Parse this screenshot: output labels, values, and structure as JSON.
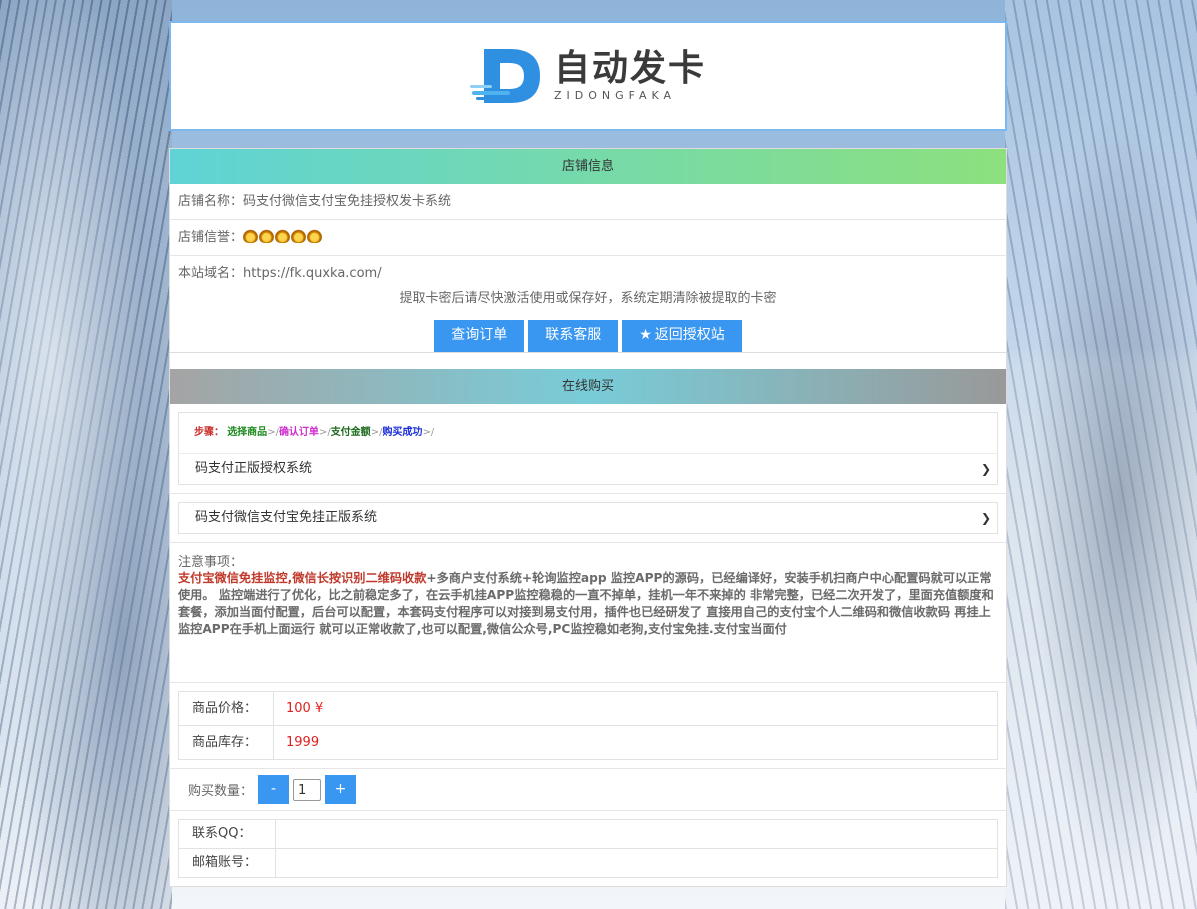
{
  "logo": {
    "title": "自动发卡",
    "subtitle": "ZIDONGFAKA"
  },
  "shop": {
    "header": "店铺信息",
    "name_label": "店铺名称：",
    "name_value": "码支付微信支付宝免挂授权发卡系统",
    "credit_label": "店铺信誉：",
    "credit_crowns": 5,
    "domain_label": "本站域名：",
    "domain_value": "https://fk.quxka.com/",
    "notice": "提取卡密后请尽快激活使用或保存好，系统定期清除被提取的卡密",
    "buttons": {
      "query": "查询订单",
      "contact": "联系客服",
      "back": "返回授权站"
    }
  },
  "buy": {
    "header": "在线购买",
    "steps": {
      "label": "步骤：",
      "s1": "选择商品",
      "s2": "确认订单",
      "s3": "支付金额",
      "s4": "购买成功",
      "arrow": ">/"
    },
    "category_selected": "码支付正版授权系统",
    "product_selected": "码支付微信支付宝免挂正版系统",
    "desc_label": "注意事项：",
    "desc_red": "支付宝微信免挂监控,微信长按识别二维码收款",
    "desc_body": "+多商户支付系统+轮询监控app 监控APP的源码，已经编译好，安装手机扫商户中心配置码就可以正常使用。 监控端进行了优化，比之前稳定多了，在云手机挂APP监控稳稳的一直不掉单，挂机一年不来掉的 非常完整，已经二次开发了，里面充值额度和套餐，添加当面付配置，后台可以配置，本套码支付程序可以对接到易支付用，插件也已经研发了 直接用自己的支付宝个人二维码和微信收款码 再挂上监控APP在手机上面运行 就可以正常收款了,也可以配置,微信公众号,PC监控稳如老狗,支付宝免挂.支付宝当面付",
    "price_label": "商品价格：",
    "price_value": "100 ¥",
    "stock_label": "商品库存：",
    "stock_value": "1999",
    "qty_label": "购买数量：",
    "qty_minus": "-",
    "qty_value": "1",
    "qty_plus": "+",
    "qq_label": "联系QQ：",
    "email_label": "邮箱账号："
  },
  "colors": {
    "primary_button": "#3a97f1",
    "logo_border": "#7ab8ee",
    "price_red": "#e02020"
  }
}
